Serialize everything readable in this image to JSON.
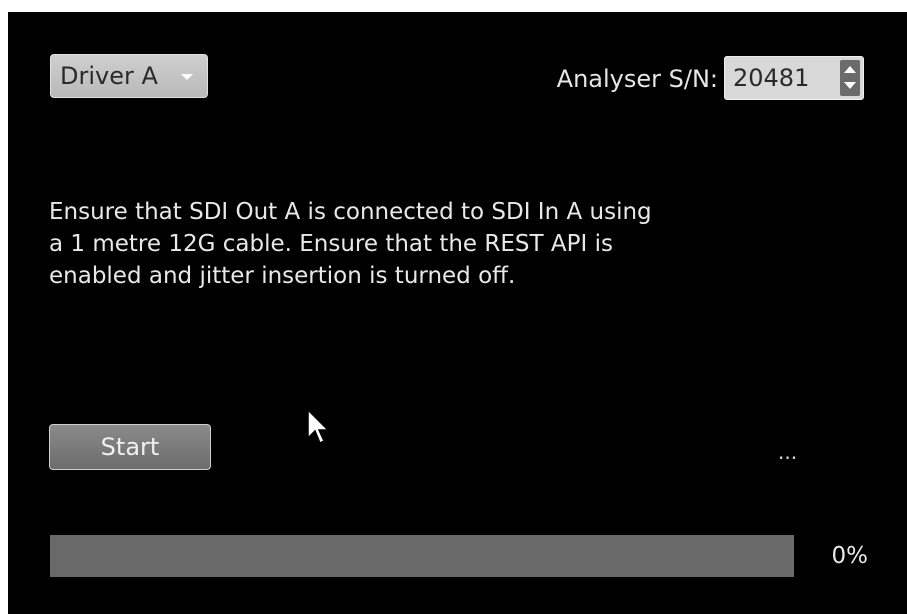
{
  "driver_select": {
    "value": "Driver A"
  },
  "analyser_sn": {
    "label": "Analyser S/N:",
    "value": "20481"
  },
  "instructions": [
    "Ensure that SDI Out A is connected to SDI In A using",
    "a 1 metre 12G cable.  Ensure that the REST API is",
    "enabled and jitter insertion is turned off."
  ],
  "start_button": {
    "label": "Start"
  },
  "status": {
    "text": "..."
  },
  "progress": {
    "value": 0,
    "label": "0%"
  },
  "icons": [
    "chevron-down-icon",
    "spinner-up-icon",
    "spinner-down-icon",
    "mouse-pointer-icon"
  ],
  "colors": {
    "background": "#000000",
    "text": "#e8e8e8",
    "progress_track": "#696969"
  }
}
